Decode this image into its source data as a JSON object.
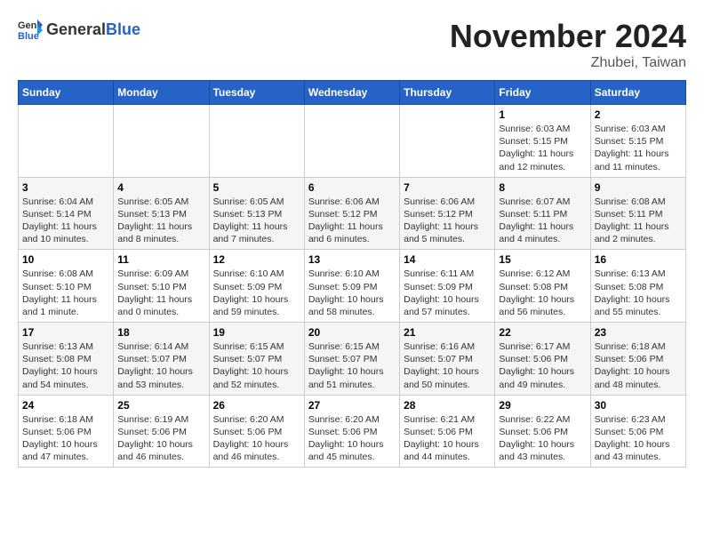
{
  "logo": {
    "general": "General",
    "blue": "Blue"
  },
  "header": {
    "title": "November 2024",
    "subtitle": "Zhubei, Taiwan"
  },
  "weekdays": [
    "Sunday",
    "Monday",
    "Tuesday",
    "Wednesday",
    "Thursday",
    "Friday",
    "Saturday"
  ],
  "weeks": [
    [
      {
        "day": "",
        "info": ""
      },
      {
        "day": "",
        "info": ""
      },
      {
        "day": "",
        "info": ""
      },
      {
        "day": "",
        "info": ""
      },
      {
        "day": "",
        "info": ""
      },
      {
        "day": "1",
        "info": "Sunrise: 6:03 AM\nSunset: 5:15 PM\nDaylight: 11 hours and 12 minutes."
      },
      {
        "day": "2",
        "info": "Sunrise: 6:03 AM\nSunset: 5:15 PM\nDaylight: 11 hours and 11 minutes."
      }
    ],
    [
      {
        "day": "3",
        "info": "Sunrise: 6:04 AM\nSunset: 5:14 PM\nDaylight: 11 hours and 10 minutes."
      },
      {
        "day": "4",
        "info": "Sunrise: 6:05 AM\nSunset: 5:13 PM\nDaylight: 11 hours and 8 minutes."
      },
      {
        "day": "5",
        "info": "Sunrise: 6:05 AM\nSunset: 5:13 PM\nDaylight: 11 hours and 7 minutes."
      },
      {
        "day": "6",
        "info": "Sunrise: 6:06 AM\nSunset: 5:12 PM\nDaylight: 11 hours and 6 minutes."
      },
      {
        "day": "7",
        "info": "Sunrise: 6:06 AM\nSunset: 5:12 PM\nDaylight: 11 hours and 5 minutes."
      },
      {
        "day": "8",
        "info": "Sunrise: 6:07 AM\nSunset: 5:11 PM\nDaylight: 11 hours and 4 minutes."
      },
      {
        "day": "9",
        "info": "Sunrise: 6:08 AM\nSunset: 5:11 PM\nDaylight: 11 hours and 2 minutes."
      }
    ],
    [
      {
        "day": "10",
        "info": "Sunrise: 6:08 AM\nSunset: 5:10 PM\nDaylight: 11 hours and 1 minute."
      },
      {
        "day": "11",
        "info": "Sunrise: 6:09 AM\nSunset: 5:10 PM\nDaylight: 11 hours and 0 minutes."
      },
      {
        "day": "12",
        "info": "Sunrise: 6:10 AM\nSunset: 5:09 PM\nDaylight: 10 hours and 59 minutes."
      },
      {
        "day": "13",
        "info": "Sunrise: 6:10 AM\nSunset: 5:09 PM\nDaylight: 10 hours and 58 minutes."
      },
      {
        "day": "14",
        "info": "Sunrise: 6:11 AM\nSunset: 5:09 PM\nDaylight: 10 hours and 57 minutes."
      },
      {
        "day": "15",
        "info": "Sunrise: 6:12 AM\nSunset: 5:08 PM\nDaylight: 10 hours and 56 minutes."
      },
      {
        "day": "16",
        "info": "Sunrise: 6:13 AM\nSunset: 5:08 PM\nDaylight: 10 hours and 55 minutes."
      }
    ],
    [
      {
        "day": "17",
        "info": "Sunrise: 6:13 AM\nSunset: 5:08 PM\nDaylight: 10 hours and 54 minutes."
      },
      {
        "day": "18",
        "info": "Sunrise: 6:14 AM\nSunset: 5:07 PM\nDaylight: 10 hours and 53 minutes."
      },
      {
        "day": "19",
        "info": "Sunrise: 6:15 AM\nSunset: 5:07 PM\nDaylight: 10 hours and 52 minutes."
      },
      {
        "day": "20",
        "info": "Sunrise: 6:15 AM\nSunset: 5:07 PM\nDaylight: 10 hours and 51 minutes."
      },
      {
        "day": "21",
        "info": "Sunrise: 6:16 AM\nSunset: 5:07 PM\nDaylight: 10 hours and 50 minutes."
      },
      {
        "day": "22",
        "info": "Sunrise: 6:17 AM\nSunset: 5:06 PM\nDaylight: 10 hours and 49 minutes."
      },
      {
        "day": "23",
        "info": "Sunrise: 6:18 AM\nSunset: 5:06 PM\nDaylight: 10 hours and 48 minutes."
      }
    ],
    [
      {
        "day": "24",
        "info": "Sunrise: 6:18 AM\nSunset: 5:06 PM\nDaylight: 10 hours and 47 minutes."
      },
      {
        "day": "25",
        "info": "Sunrise: 6:19 AM\nSunset: 5:06 PM\nDaylight: 10 hours and 46 minutes."
      },
      {
        "day": "26",
        "info": "Sunrise: 6:20 AM\nSunset: 5:06 PM\nDaylight: 10 hours and 46 minutes."
      },
      {
        "day": "27",
        "info": "Sunrise: 6:20 AM\nSunset: 5:06 PM\nDaylight: 10 hours and 45 minutes."
      },
      {
        "day": "28",
        "info": "Sunrise: 6:21 AM\nSunset: 5:06 PM\nDaylight: 10 hours and 44 minutes."
      },
      {
        "day": "29",
        "info": "Sunrise: 6:22 AM\nSunset: 5:06 PM\nDaylight: 10 hours and 43 minutes."
      },
      {
        "day": "30",
        "info": "Sunrise: 6:23 AM\nSunset: 5:06 PM\nDaylight: 10 hours and 43 minutes."
      }
    ]
  ]
}
